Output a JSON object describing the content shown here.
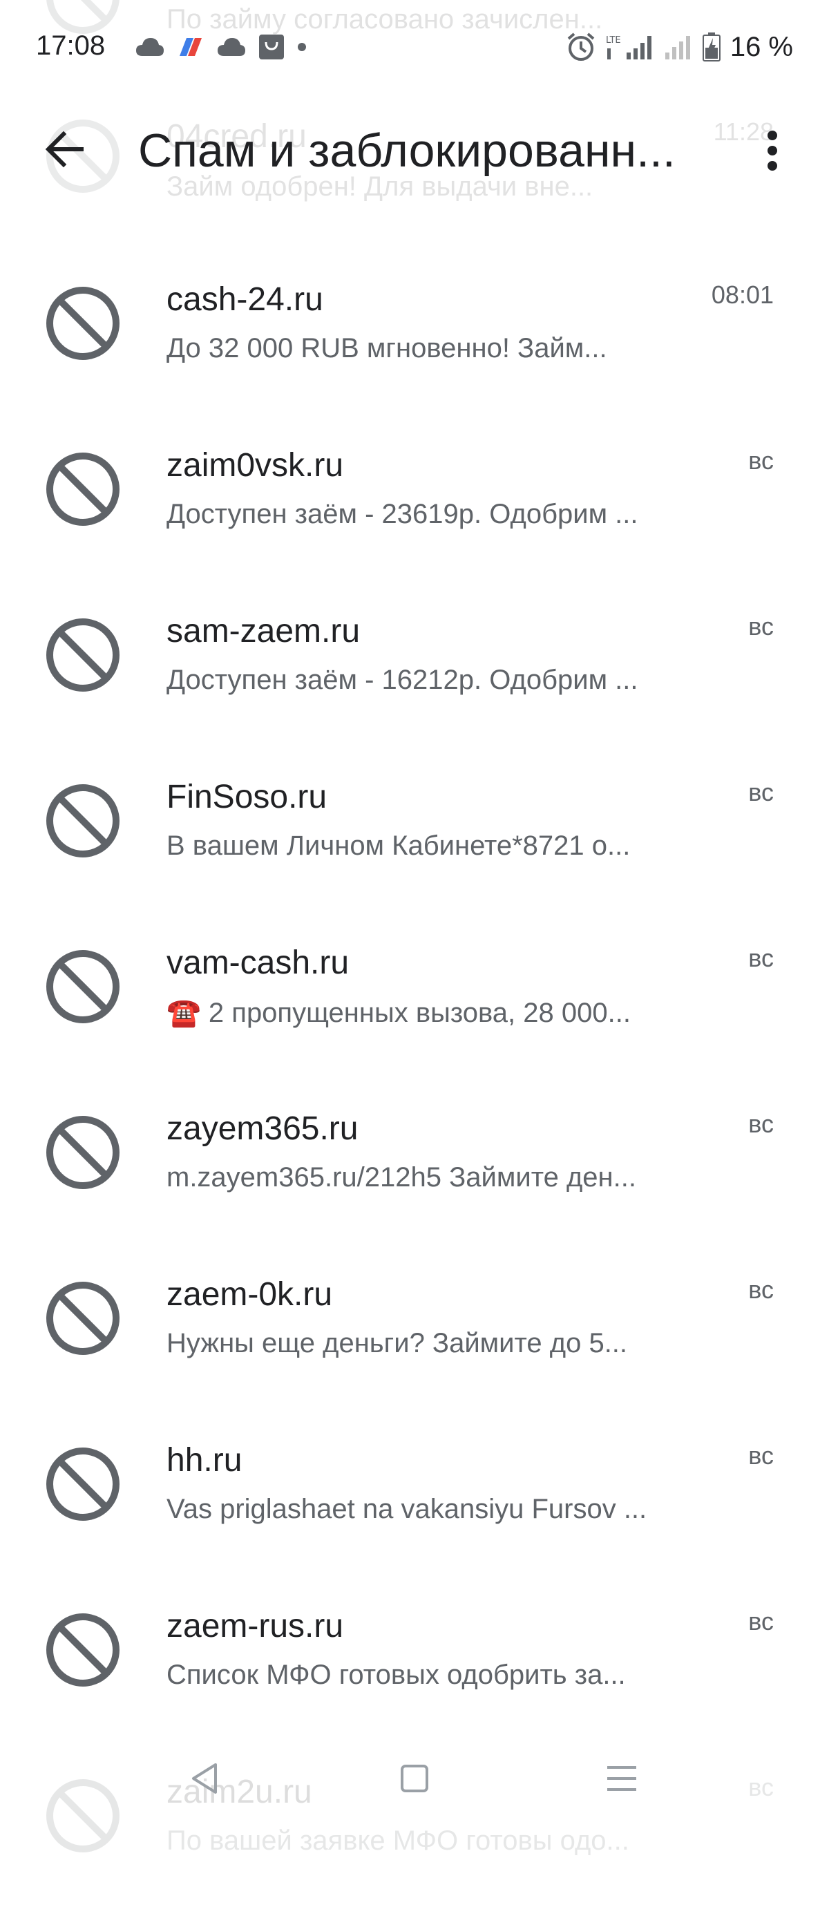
{
  "status_bar": {
    "time": "17:08",
    "battery_percent": "16 %",
    "network_label": "LTE",
    "left_icons": [
      "cloud-icon",
      "app-logo-icon",
      "cloud-icon",
      "shopping-bag-icon",
      "dot-icon"
    ],
    "right_icons": [
      "alarm-icon",
      "signal-icon",
      "signal-icon",
      "battery-icon"
    ]
  },
  "ghost_items": [
    {
      "snippet": "По займу согласовано зачислен..."
    },
    {
      "sender": "04cred.ru",
      "time": "11:28",
      "snippet": "Займ одобрен! Для выдачи вне..."
    }
  ],
  "app_bar": {
    "title": "Спам и заблокированн...",
    "back_icon": "arrow-back-icon",
    "more_icon": "more-vert-icon"
  },
  "conversations": [
    {
      "sender": "cash-24.ru",
      "snippet": "До 32 000 RUB мгновенно! Займ...",
      "time": "08:01",
      "icon": "block-icon"
    },
    {
      "sender": "zaim0vsk.ru",
      "snippet": "Доступен заём - 23619р. Одобрим ...",
      "time": "вс",
      "icon": "block-icon"
    },
    {
      "sender": "sam-zaem.ru",
      "snippet": "Доступен заём - 16212р. Одобрим ...",
      "time": "вс",
      "icon": "block-icon"
    },
    {
      "sender": "FinSoso.ru",
      "snippet": "В вашем Личном Кабинете*8721 о...",
      "time": "вс",
      "icon": "block-icon"
    },
    {
      "sender": "vam-cash.ru",
      "snippet": "☎️ 2 пропущенных вызова, 28 000...",
      "time": "вс",
      "icon": "block-icon"
    },
    {
      "sender": "zayem365.ru",
      "snippet": "m.zayem365.ru/212h5 Займите ден...",
      "time": "вс",
      "icon": "block-icon"
    },
    {
      "sender": "zaem-0k.ru",
      "snippet": "Нужны еще деньги? Займите до 5...",
      "time": "вс",
      "icon": "block-icon"
    },
    {
      "sender": "hh.ru",
      "snippet": "Vas priglashaet na vakansiyu Fursov ...",
      "time": "вс",
      "icon": "block-icon"
    },
    {
      "sender": "zaem-rus.ru",
      "snippet": "Список МФО готовых одобрить за...",
      "time": "вс",
      "icon": "block-icon"
    },
    {
      "sender": "zaim2u.ru",
      "snippet": "По вашей заявке МФО готовы одо...",
      "time": "вс",
      "icon": "block-icon"
    }
  ],
  "nav_bar": {
    "back_icon": "nav-back-icon",
    "home_icon": "nav-home-icon",
    "menu_icon": "nav-menu-icon"
  },
  "colors": {
    "icon": "#5f6368",
    "text_primary": "#202124",
    "text_secondary": "#5f6368",
    "background": "#ffffff",
    "accent_app_logo_blue": "#3f7ee8",
    "accent_app_logo_red": "#e8453c"
  }
}
